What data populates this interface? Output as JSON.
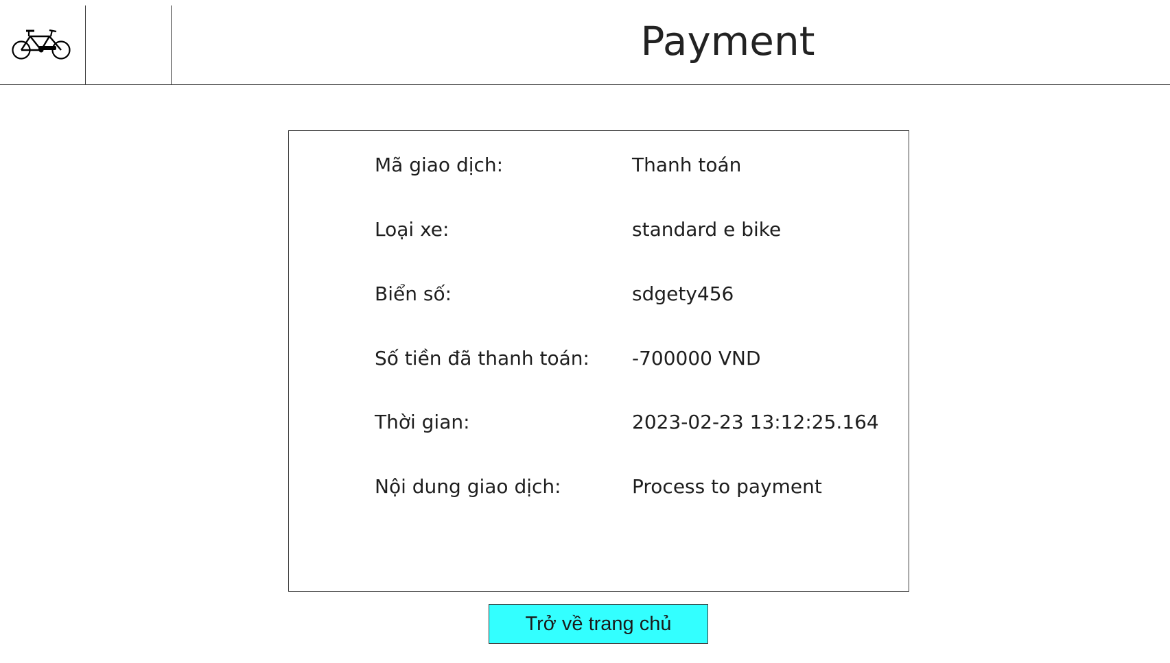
{
  "header": {
    "logo_icon": "bicycle-icon",
    "title": "Payment"
  },
  "transaction": {
    "rows": [
      {
        "label": "Mã giao dịch:",
        "value": "Thanh toán"
      },
      {
        "label": "Loại xe:",
        "value": "standard e bike"
      },
      {
        "label": "Biển số:",
        "value": "sdgety456"
      },
      {
        "label": "Số tiền đã thanh toán:",
        "value": "-700000 VND"
      },
      {
        "label": "Thời gian:",
        "value": "2023-02-23 13:12:25.164"
      },
      {
        "label": "Nội dung giao dịch:",
        "value": "Process to payment"
      }
    ]
  },
  "actions": {
    "home_label": "Trở về trang chủ"
  },
  "colors": {
    "button_bg": "#33ffff",
    "border": "#3a3a3a",
    "text": "#1e1e1e"
  }
}
